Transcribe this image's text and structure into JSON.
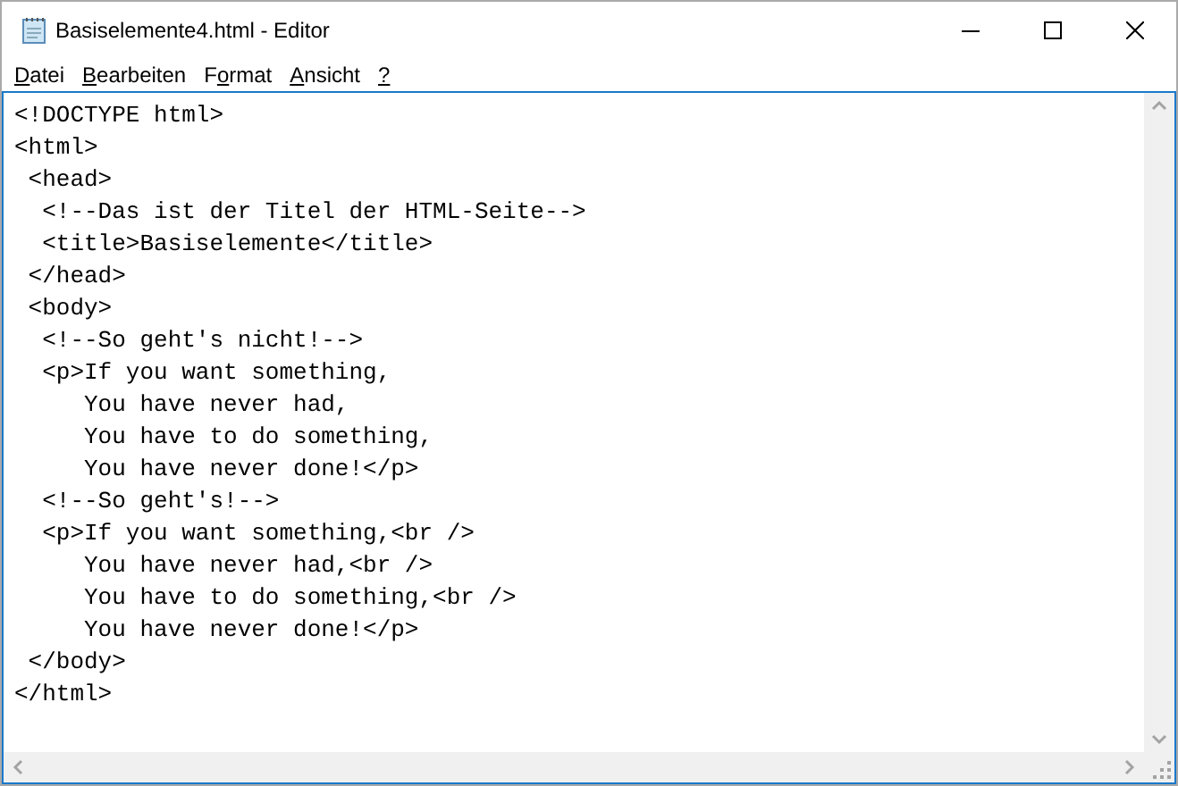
{
  "window": {
    "title": "Basiselemente4.html - Editor"
  },
  "menu": [
    {
      "key": "D",
      "rest": "atei"
    },
    {
      "key": "B",
      "rest": "earbeiten"
    },
    {
      "prefix": "F",
      "key": "o",
      "rest": "rmat"
    },
    {
      "key": "A",
      "rest": "nsicht"
    },
    {
      "key": "?"
    }
  ],
  "editor": {
    "lines": [
      "<!DOCTYPE html>",
      "<html>",
      " <head>",
      "  <!--Das ist der Titel der HTML-Seite-->",
      "  <title>Basiselemente</title>",
      " </head>",
      " <body>",
      "  <!--So geht's nicht!-->",
      "  <p>If you want something,",
      "     You have never had,",
      "     You have to do something,",
      "     You have never done!</p>",
      "  <!--So geht's!-->",
      "  <p>If you want something,<br />",
      "     You have never had,<br />",
      "     You have to do something,<br />",
      "     You have never done!</p>",
      " </body>",
      "</html>"
    ]
  }
}
